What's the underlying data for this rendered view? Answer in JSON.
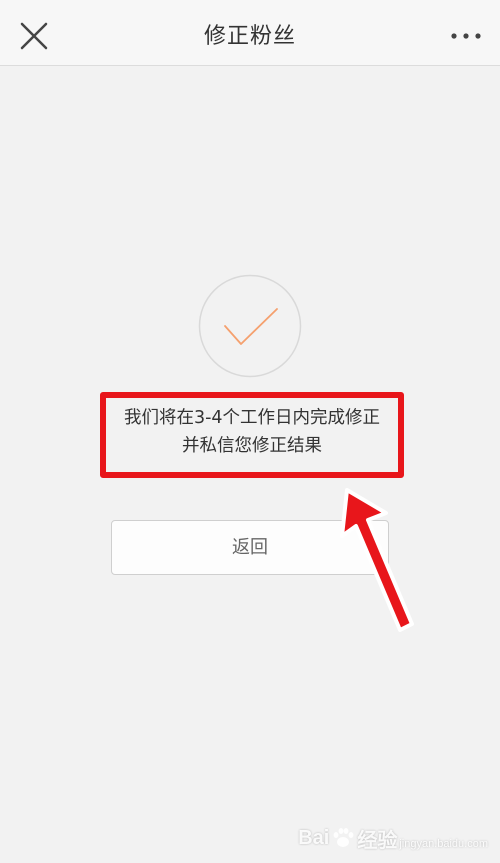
{
  "header": {
    "title": "修正粉丝",
    "close_icon": "close-icon",
    "more_icon": "more-icon"
  },
  "status": {
    "icon": "checkmark-icon",
    "check_color": "#f5a06e",
    "message_line1": "我们将在3-4个工作日内完成修正",
    "message_line2": "并私信您修正结果"
  },
  "actions": {
    "back_label": "返回"
  },
  "annotation": {
    "highlight_color": "#e8161b",
    "arrow_color": "#e8161b"
  },
  "watermark": {
    "text_left": "Bai",
    "text_right": "经验",
    "text_sub": "jingyan.baidu.com"
  }
}
